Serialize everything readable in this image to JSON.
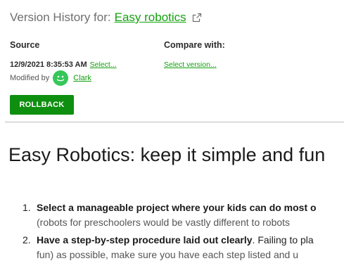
{
  "header": {
    "prefix": "Version History for:",
    "page_link": "Easy robotics",
    "external_icon": "external-link-icon"
  },
  "source": {
    "label": "Source",
    "timestamp": "12/9/2021 8:35:53 AM",
    "select_link": "Select...",
    "modified_by_label": "Modified by",
    "avatar_icon": "smiley-avatar-icon",
    "user": "Clark"
  },
  "compare": {
    "label": "Compare with:",
    "select_link": "Select version..."
  },
  "actions": {
    "rollback_label": "ROLLBACK"
  },
  "document": {
    "heading": "Easy Robotics: keep it simple and fun",
    "items": [
      {
        "number": "1.",
        "bold": "Select a manageable project where your kids can do most o",
        "text": "",
        "second_line": "(robots for preschoolers would be vastly different to robots"
      },
      {
        "number": "2.",
        "bold": "Have a step-by-step procedure laid out clearly",
        "text": ". Failing to pla",
        "second_line": "fun) as possible, make sure you have each step listed and u"
      }
    ]
  },
  "colors": {
    "accent": "#13a10e",
    "button": "#0f8f0f",
    "avatar": "#35c759"
  }
}
